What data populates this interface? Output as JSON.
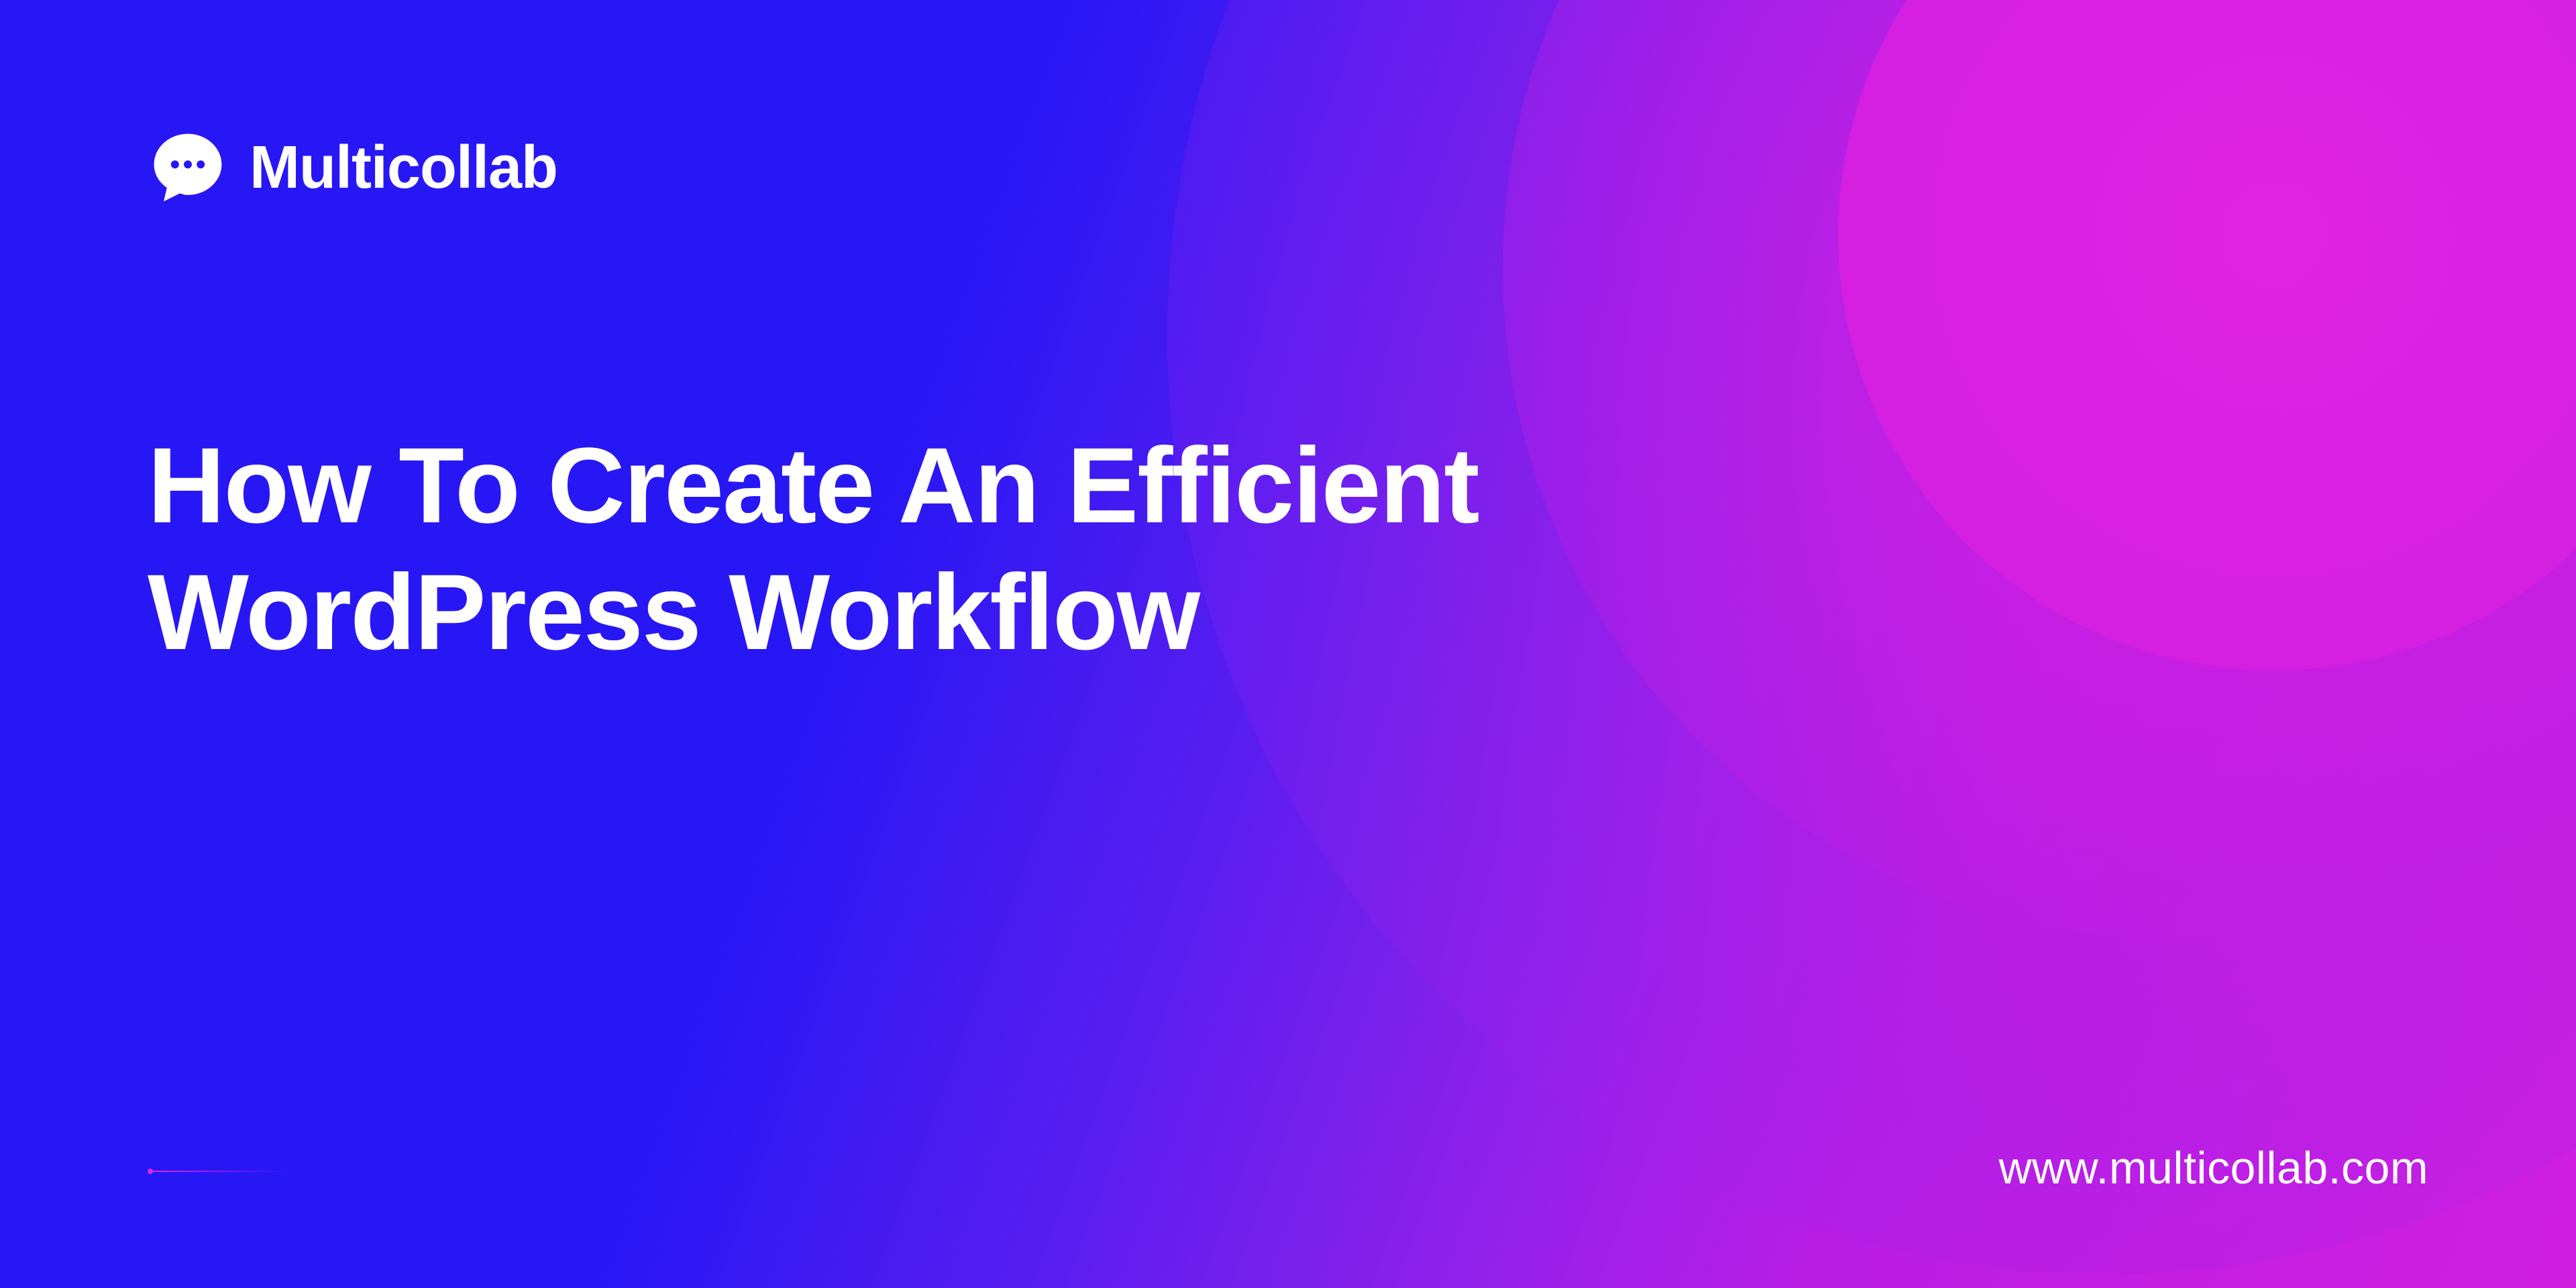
{
  "brand": {
    "name": "Multicollab",
    "icon": "chat-bubble-icon"
  },
  "headline": "How To Create An Efficient WordPress Workflow",
  "website_url": "www.multicollab.com",
  "colors": {
    "primary_blue": "#2817f5",
    "gradient_purple": "#9821ea",
    "gradient_magenta": "#d11fe0",
    "circle_magenta": "#e024e2",
    "text": "#ffffff"
  }
}
